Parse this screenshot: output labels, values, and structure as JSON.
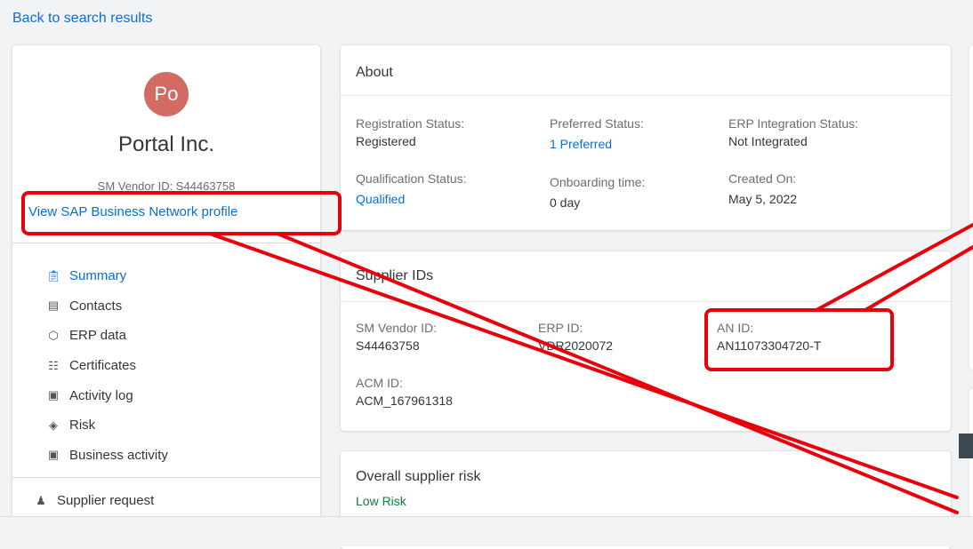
{
  "nav": {
    "back_label": "Back to search results"
  },
  "profile": {
    "initials": "Po",
    "company": "Portal Inc.",
    "vendor_id": "SM Vendor ID: S44463758",
    "network_link": "View SAP Business Network profile",
    "avatar_color": "#d16b63"
  },
  "menu": [
    {
      "label": "Summary",
      "icon": "clipboard-icon",
      "active": true
    },
    {
      "label": "Contacts",
      "icon": "contacts-icon"
    },
    {
      "label": "ERP data",
      "icon": "erp-icon"
    },
    {
      "label": "Certificates",
      "icon": "certificate-icon"
    },
    {
      "label": "Activity log",
      "icon": "activity-log-icon"
    },
    {
      "label": "Risk",
      "icon": "risk-icon"
    },
    {
      "label": "Business activity",
      "icon": "business-activity-icon"
    }
  ],
  "supplier_request": {
    "label": "Supplier request",
    "icon": "supplier-request-icon"
  },
  "about": {
    "title": "About",
    "registration_label": "Registration Status:",
    "registration_value": "Registered",
    "preferred_label": "Preferred Status:",
    "preferred_value": "1 Preferred",
    "erp_label": "ERP Integration Status:",
    "erp_value": "Not Integrated",
    "qualification_label": "Qualification Status:",
    "qualification_value": "Qualified",
    "onboarding_label": "Onboarding time:",
    "onboarding_value": "0 day",
    "created_label": "Created On:",
    "created_value": "May 5, 2022"
  },
  "supplier_ids": {
    "title": "Supplier IDs",
    "sm_label": "SM Vendor ID:",
    "sm_value": "S44463758",
    "erp_label": "ERP ID:",
    "erp_value": "VDR2020072",
    "an_label": "AN ID:",
    "an_value": "AN11073304720-T",
    "acm_label": "ACM ID:",
    "acm_value": "ACM_167961318"
  },
  "risk": {
    "title": "Overall supplier risk",
    "value": "Low Risk"
  },
  "colors": {
    "link": "#0a6ed1",
    "annotation": "#e8000b",
    "low_risk": "#107e3e"
  }
}
